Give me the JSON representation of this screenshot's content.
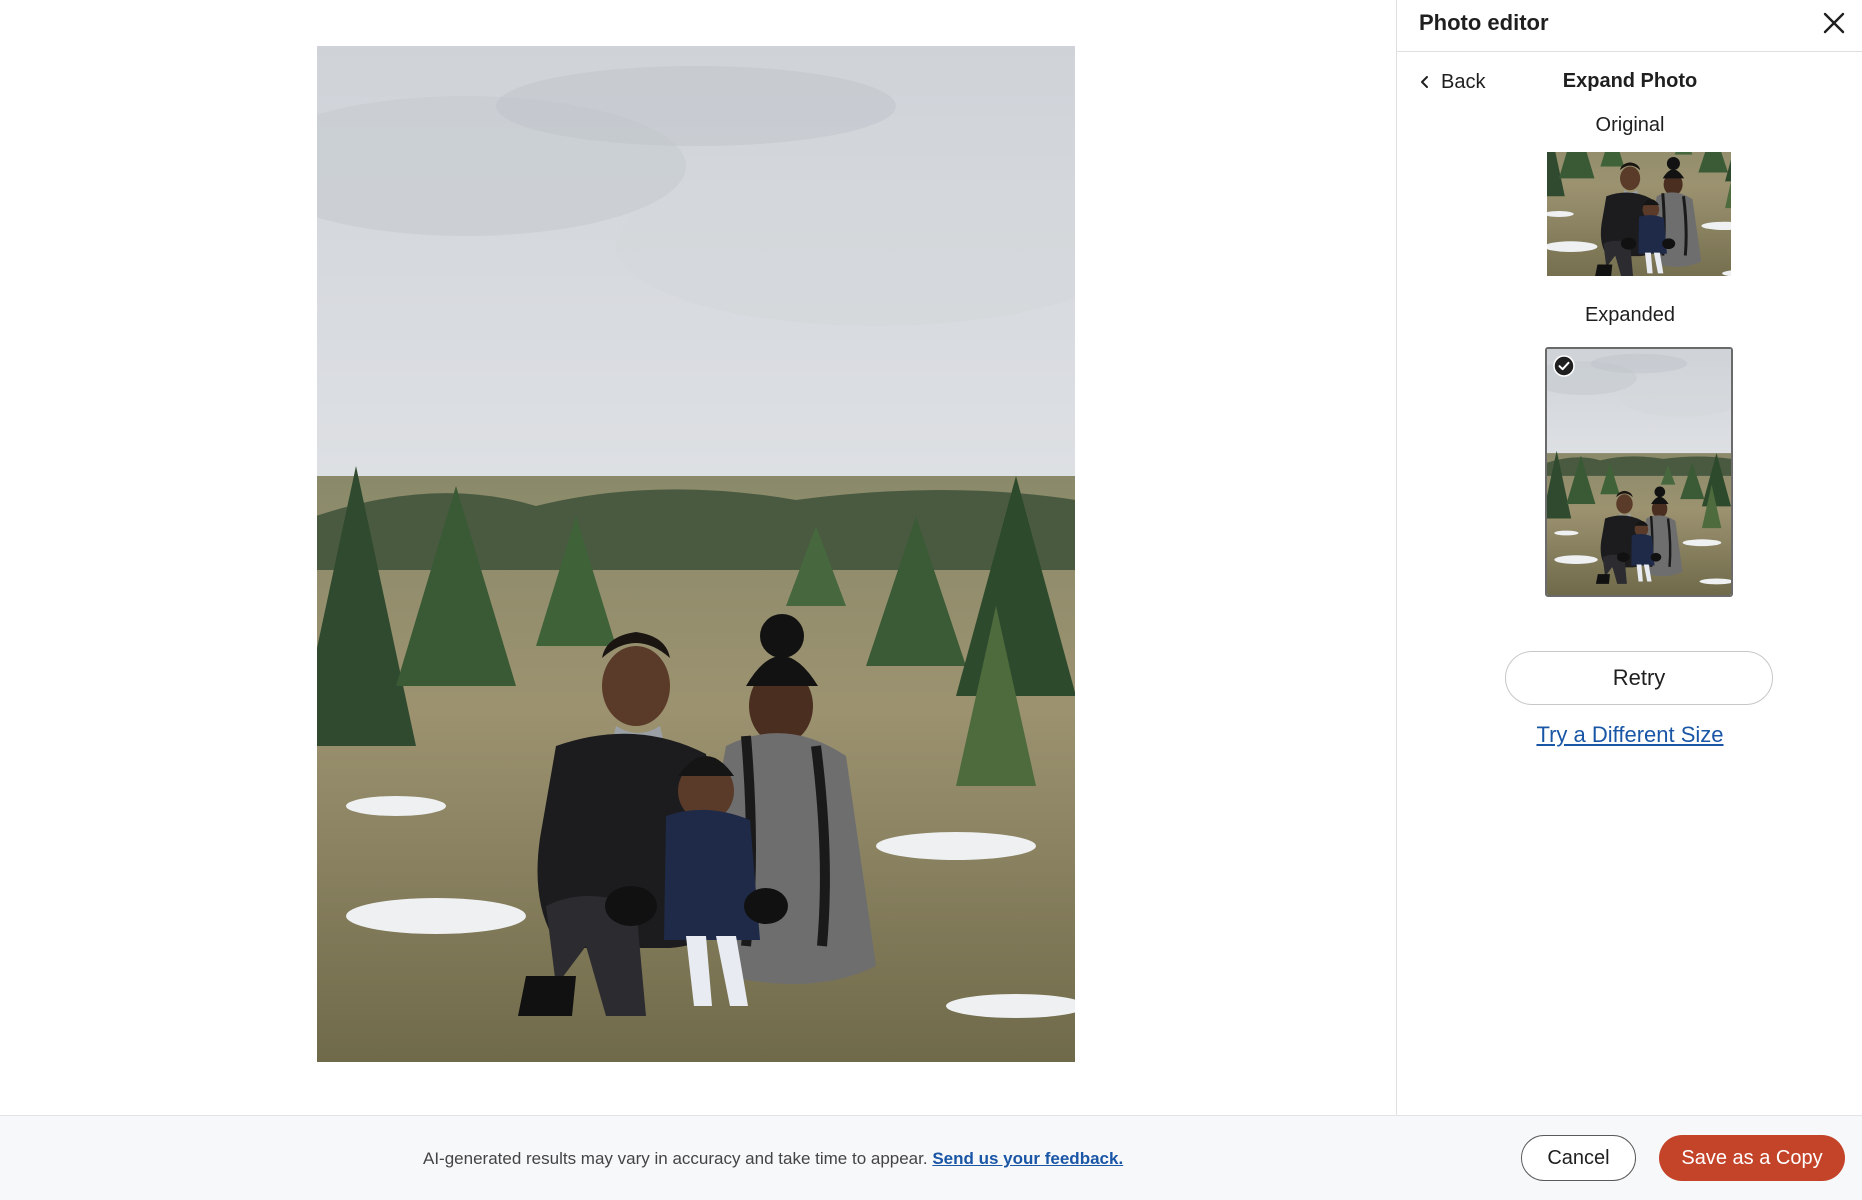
{
  "panel": {
    "title": "Photo editor",
    "back_label": "Back",
    "subtitle": "Expand Photo",
    "original_label": "Original",
    "expanded_label": "Expanded",
    "retry_label": "Retry",
    "different_size_label": "Try a Different Size"
  },
  "footer": {
    "disclaimer": "AI-generated results may vary in accuracy and take time to appear.",
    "feedback_link": "Send us your feedback.",
    "cancel_label": "Cancel",
    "save_label": "Save as a Copy"
  },
  "icons": {
    "close": "close-icon",
    "back": "chevron-left-icon",
    "selected": "checkmark-circle-icon"
  },
  "colors": {
    "accent": "#c4442a",
    "link": "#1a56a6"
  }
}
